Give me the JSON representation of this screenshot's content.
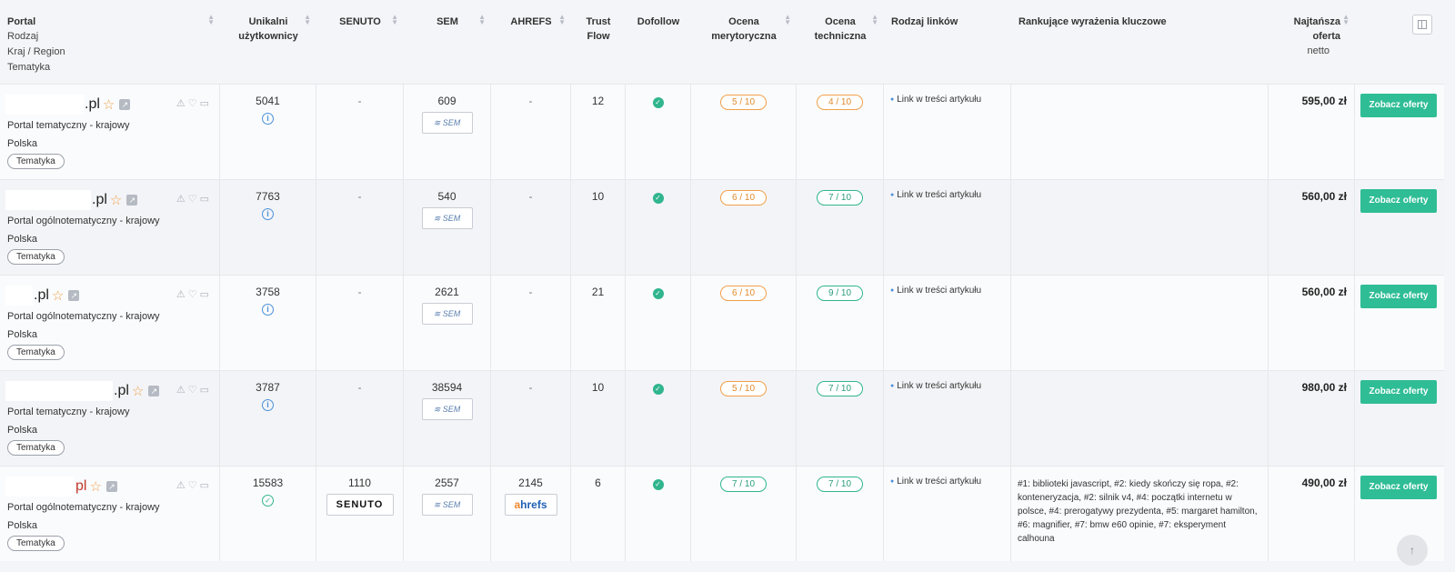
{
  "header": {
    "portal": "Portal",
    "portal_sub": [
      "Rodzaj",
      "Kraj / Region",
      "Tematyka"
    ],
    "unique_users": "Unikalni użytkownicy",
    "senuto": "SENUTO",
    "sem": "SEM",
    "ahrefs": "AHREFS",
    "trust_flow": "Trust Flow",
    "dofollow": "Dofollow",
    "merit_rating": "Ocena merytoryczna",
    "tech_rating": "Ocena techniczna",
    "link_type": "Rodzaj linków",
    "keywords": "Rankujące wyrażenia kluczowe",
    "cheapest_offer": "Najtańsza oferta",
    "net": "netto"
  },
  "icons": {
    "sort": "sort-icon",
    "star": "star-icon",
    "external": "external-link-icon",
    "report": "warning-icon",
    "favorite": "heart-icon",
    "note": "note-icon",
    "info": "info-icon",
    "verified": "check-circle-icon",
    "dofollow": "check-badge-icon",
    "columns": "columns-icon",
    "scroll_top": "arrow-up-icon"
  },
  "colors": {
    "accent": "#2fbd96",
    "orange": "#f0a04b",
    "green": "#30b58e",
    "info": "#4a90d9"
  },
  "rows": [
    {
      "tld": ".pl",
      "type": "Portal tematyczny - krajowy",
      "country": "Polska",
      "tag": "Tematyka",
      "users": "5041",
      "users_icon": "info",
      "senuto": "-",
      "sem": "609",
      "ahrefs": "-",
      "trust_flow": "12",
      "merit": "5 / 10",
      "merit_color": "orange",
      "tech": "4 / 10",
      "tech_color": "orange",
      "link": "Link w treści artykułu",
      "keywords": "",
      "price": "595,00 zł",
      "button": "Zobacz oferty"
    },
    {
      "tld": ".pl",
      "type": "Portal ogólnotematyczny - krajowy",
      "country": "Polska",
      "tag": "Tematyka",
      "users": "7763",
      "users_icon": "info",
      "senuto": "-",
      "sem": "540",
      "ahrefs": "-",
      "trust_flow": "10",
      "merit": "6 / 10",
      "merit_color": "orange",
      "tech": "7 / 10",
      "tech_color": "green",
      "link": "Link w treści artykułu",
      "keywords": "",
      "price": "560,00 zł",
      "button": "Zobacz oferty"
    },
    {
      "tld": ".pl",
      "type": "Portal ogólnotematyczny - krajowy",
      "country": "Polska",
      "tag": "Tematyka",
      "users": "3758",
      "users_icon": "info",
      "senuto": "-",
      "sem": "2621",
      "ahrefs": "-",
      "trust_flow": "21",
      "merit": "6 / 10",
      "merit_color": "orange",
      "tech": "9 / 10",
      "tech_color": "green",
      "link": "Link w treści artykułu",
      "keywords": "",
      "price": "560,00 zł",
      "button": "Zobacz oferty"
    },
    {
      "tld": ".pl",
      "type": "Portal tematyczny - krajowy",
      "country": "Polska",
      "tag": "Tematyka",
      "users": "3787",
      "users_icon": "info",
      "senuto": "-",
      "sem": "38594",
      "ahrefs": "-",
      "trust_flow": "10",
      "merit": "5 / 10",
      "merit_color": "orange",
      "tech": "7 / 10",
      "tech_color": "green",
      "link": "Link w treści artykułu",
      "keywords": "",
      "price": "980,00 zł",
      "button": "Zobacz oferty"
    },
    {
      "tld": "pl",
      "type": "Portal ogólnotematyczny - krajowy",
      "country": "Polska",
      "tag": "Tematyka",
      "users": "15583",
      "users_icon": "verified",
      "senuto": "1110",
      "sem": "2557",
      "ahrefs": "2145",
      "trust_flow": "6",
      "merit": "7 / 10",
      "merit_color": "green",
      "tech": "7 / 10",
      "tech_color": "green",
      "link": "Link w treści artykułu",
      "keywords": "#1: biblioteki javascript, #2: kiedy skończy się ropa, #2: konteneryzacja, #2: silnik v4, #4: początki internetu w polsce, #4: prerogatywy prezydenta, #5: margaret hamilton, #6: magnifier, #7: bmw e60 opinie, #7: eksperyment calhouna",
      "price": "490,00 zł",
      "button": "Zobacz oferty"
    }
  ]
}
